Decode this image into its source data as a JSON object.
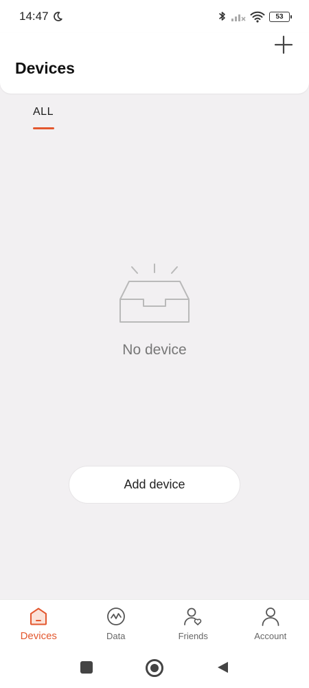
{
  "status_bar": {
    "time": "14:47",
    "battery": "53",
    "icons": [
      "moon-icon",
      "bluetooth-icon",
      "signal-icon",
      "wifi-icon",
      "battery-icon"
    ]
  },
  "header": {
    "title": "Devices",
    "add_icon": "plus-icon"
  },
  "tabs": [
    {
      "label": "ALL",
      "active": true
    }
  ],
  "empty_state": {
    "icon": "empty-box-icon",
    "message": "No device"
  },
  "add_device_button": {
    "label": "Add device"
  },
  "bottom_nav": {
    "items": [
      {
        "label": "Devices",
        "icon": "home-icon",
        "active": true
      },
      {
        "label": "Data",
        "icon": "chart-icon",
        "active": false
      },
      {
        "label": "Friends",
        "icon": "friends-icon",
        "active": false
      },
      {
        "label": "Account",
        "icon": "account-icon",
        "active": false
      }
    ]
  },
  "colors": {
    "accent": "#e3572e",
    "background": "#f2f0f2",
    "surface": "#ffffff"
  }
}
